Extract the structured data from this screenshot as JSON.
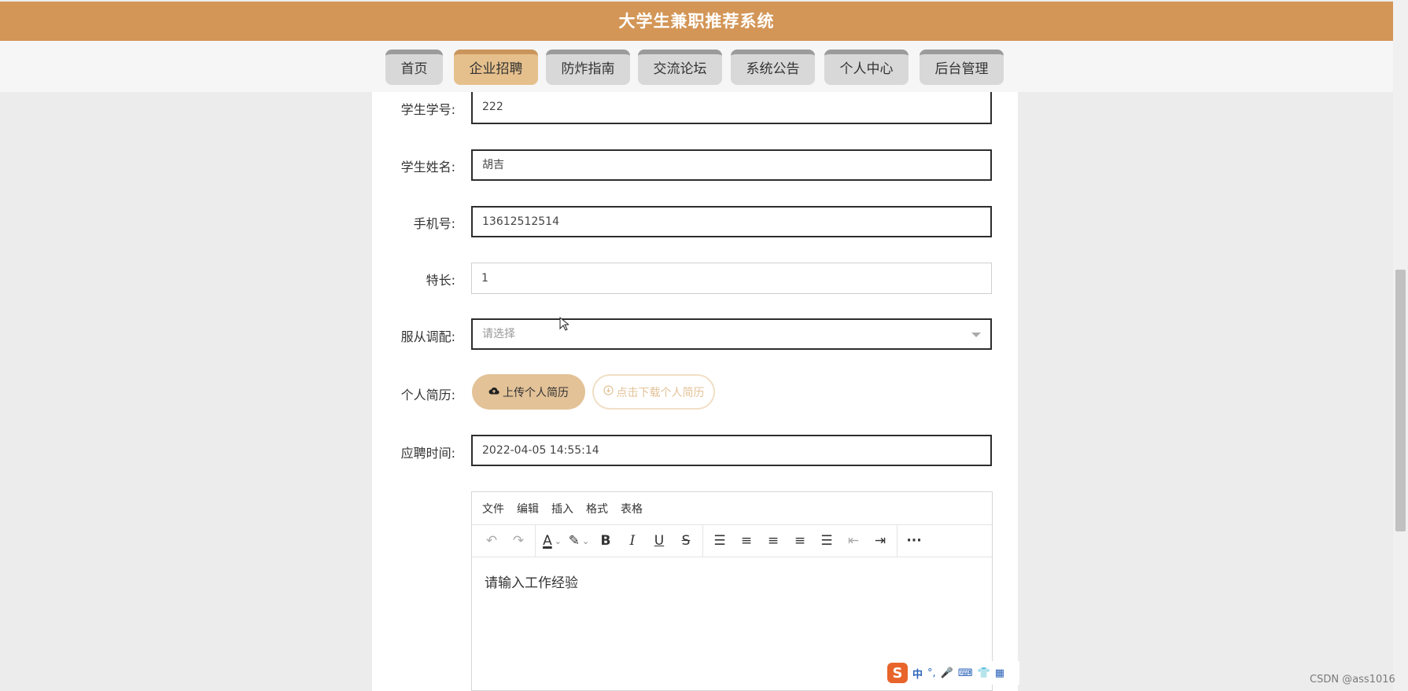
{
  "app": {
    "title": "大学生兼职推荐系统"
  },
  "nav": {
    "tabs": [
      {
        "label": "首页",
        "active": false
      },
      {
        "label": "企业招聘",
        "active": true
      },
      {
        "label": "防炸指南",
        "active": false
      },
      {
        "label": "交流论坛",
        "active": false
      },
      {
        "label": "系统公告",
        "active": false
      },
      {
        "label": "个人中心",
        "active": false
      },
      {
        "label": "后台管理",
        "active": false
      }
    ]
  },
  "form": {
    "student_id": {
      "label": "学生学号:",
      "value": "222"
    },
    "student_name": {
      "label": "学生姓名:",
      "value": "胡吉"
    },
    "phone": {
      "label": "手机号:",
      "value": "13612512514"
    },
    "specialty": {
      "label": "特长:",
      "value": "1"
    },
    "adjustment": {
      "label": "服从调配:",
      "placeholder": "请选择"
    },
    "resume": {
      "label": "个人简历:",
      "upload_label": "上传个人简历",
      "download_label": "点击下载个人简历"
    },
    "apply_time": {
      "label": "应聘时间:",
      "value": "2022-04-05 14:55:14"
    }
  },
  "editor": {
    "menu": [
      "文件",
      "编辑",
      "插入",
      "格式",
      "表格"
    ],
    "placeholder": "请输入工作经验",
    "tools": [
      "undo-icon",
      "redo-icon",
      "font-color-icon",
      "highlight-icon",
      "bold-icon",
      "italic-icon",
      "underline-icon",
      "strikethrough-icon",
      "line-height-icon",
      "align-left-icon",
      "align-center-icon",
      "align-right-icon",
      "align-justify-icon",
      "outdent-icon",
      "indent-icon",
      "more-icon"
    ]
  },
  "ime": {
    "items": [
      "中",
      "°,",
      "mic",
      "keyboard",
      "shirt",
      "apps"
    ]
  },
  "watermark": "CSDN @ass1016",
  "colors": {
    "header": "#d39657",
    "active_tab": "#e6c08c",
    "upload_button": "#e3c297"
  }
}
